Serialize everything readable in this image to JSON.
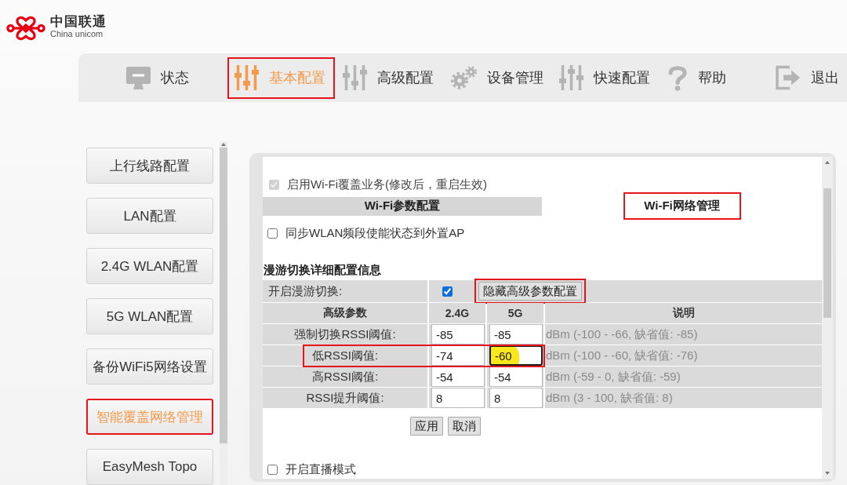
{
  "logo": {
    "title": "中国联通",
    "subtitle": "China unicom"
  },
  "nav": [
    {
      "kind": "status",
      "label": "状态",
      "selected": false,
      "annotated": false
    },
    {
      "kind": "basic",
      "label": "基本配置",
      "selected": true,
      "annotated": true
    },
    {
      "kind": "advanced",
      "label": "高级配置",
      "selected": false,
      "annotated": false
    },
    {
      "kind": "device",
      "label": "设备管理",
      "selected": false,
      "annotated": false
    },
    {
      "kind": "quick",
      "label": "快速配置",
      "selected": false,
      "annotated": false
    },
    {
      "kind": "help",
      "label": "帮助",
      "selected": false,
      "annotated": false
    },
    {
      "kind": "logout",
      "label": "退出",
      "selected": false,
      "annotated": false
    }
  ],
  "sidebar": {
    "items": [
      {
        "label": "上行线路配置",
        "selected": false,
        "annotated": false
      },
      {
        "label": "LAN配置",
        "selected": false,
        "annotated": false
      },
      {
        "label": "2.4G WLAN配置",
        "selected": false,
        "annotated": false
      },
      {
        "label": "5G WLAN配置",
        "selected": false,
        "annotated": false
      },
      {
        "label": "备份WiFi5网络设置",
        "selected": false,
        "annotated": false
      },
      {
        "label": "智能覆盖网络管理",
        "selected": true,
        "annotated": true
      },
      {
        "label": "EasyMesh Topo",
        "selected": false,
        "annotated": false
      }
    ]
  },
  "panel": {
    "coverage": {
      "label": "启用Wi-Fi覆盖业务(修改后，重启生效)",
      "checked": true,
      "disabled": true
    },
    "tabs": [
      {
        "label": "Wi-Fi参数配置",
        "selected": false,
        "annotated": false
      },
      {
        "label": "Wi-Fi网络管理",
        "selected": true,
        "annotated": true
      }
    ],
    "sync": {
      "label": "同步WLAN频段使能状态到外置AP",
      "checked": false
    },
    "section_title": "漫游切换详细配置信息",
    "roaming": {
      "label": "开启漫游切换:",
      "checked": true,
      "toggle": {
        "label": "隐藏高级参数配置",
        "annotated": true
      }
    },
    "table": {
      "columns": [
        "高级参数",
        "2.4G",
        "5G",
        "说明"
      ],
      "rows": [
        {
          "name": "强制切换RSSI阈值:",
          "annotated": false,
          "cells": [
            {
              "value": "-85",
              "focused": false,
              "click_marker": false
            },
            {
              "value": "-85",
              "focused": false,
              "click_marker": false
            }
          ],
          "note": "dBm (-100 - -66, 缺省值: -85)"
        },
        {
          "name": "低RSSI阈值:",
          "annotated": true,
          "cells": [
            {
              "value": "-74",
              "focused": false,
              "click_marker": false
            },
            {
              "value": "-60",
              "focused": true,
              "click_marker": true
            }
          ],
          "note": "dBm (-100 - -60, 缺省值: -76)"
        },
        {
          "name": "高RSSI阈值:",
          "annotated": false,
          "cells": [
            {
              "value": "-54",
              "focused": false,
              "click_marker": false
            },
            {
              "value": "-54",
              "focused": false,
              "click_marker": false
            }
          ],
          "note": "dBm (-59 - 0, 缺省值: -59)"
        },
        {
          "name": "RSSI提升阈值:",
          "annotated": false,
          "cells": [
            {
              "value": "8",
              "focused": false,
              "click_marker": false
            },
            {
              "value": "8",
              "focused": false,
              "click_marker": false
            }
          ],
          "note": "dBm (3 - 100, 缺省值: 8)"
        }
      ]
    },
    "buttons": [
      "应用",
      "取消"
    ],
    "live_mode": {
      "label": "开启直播模式",
      "checked": false
    }
  }
}
